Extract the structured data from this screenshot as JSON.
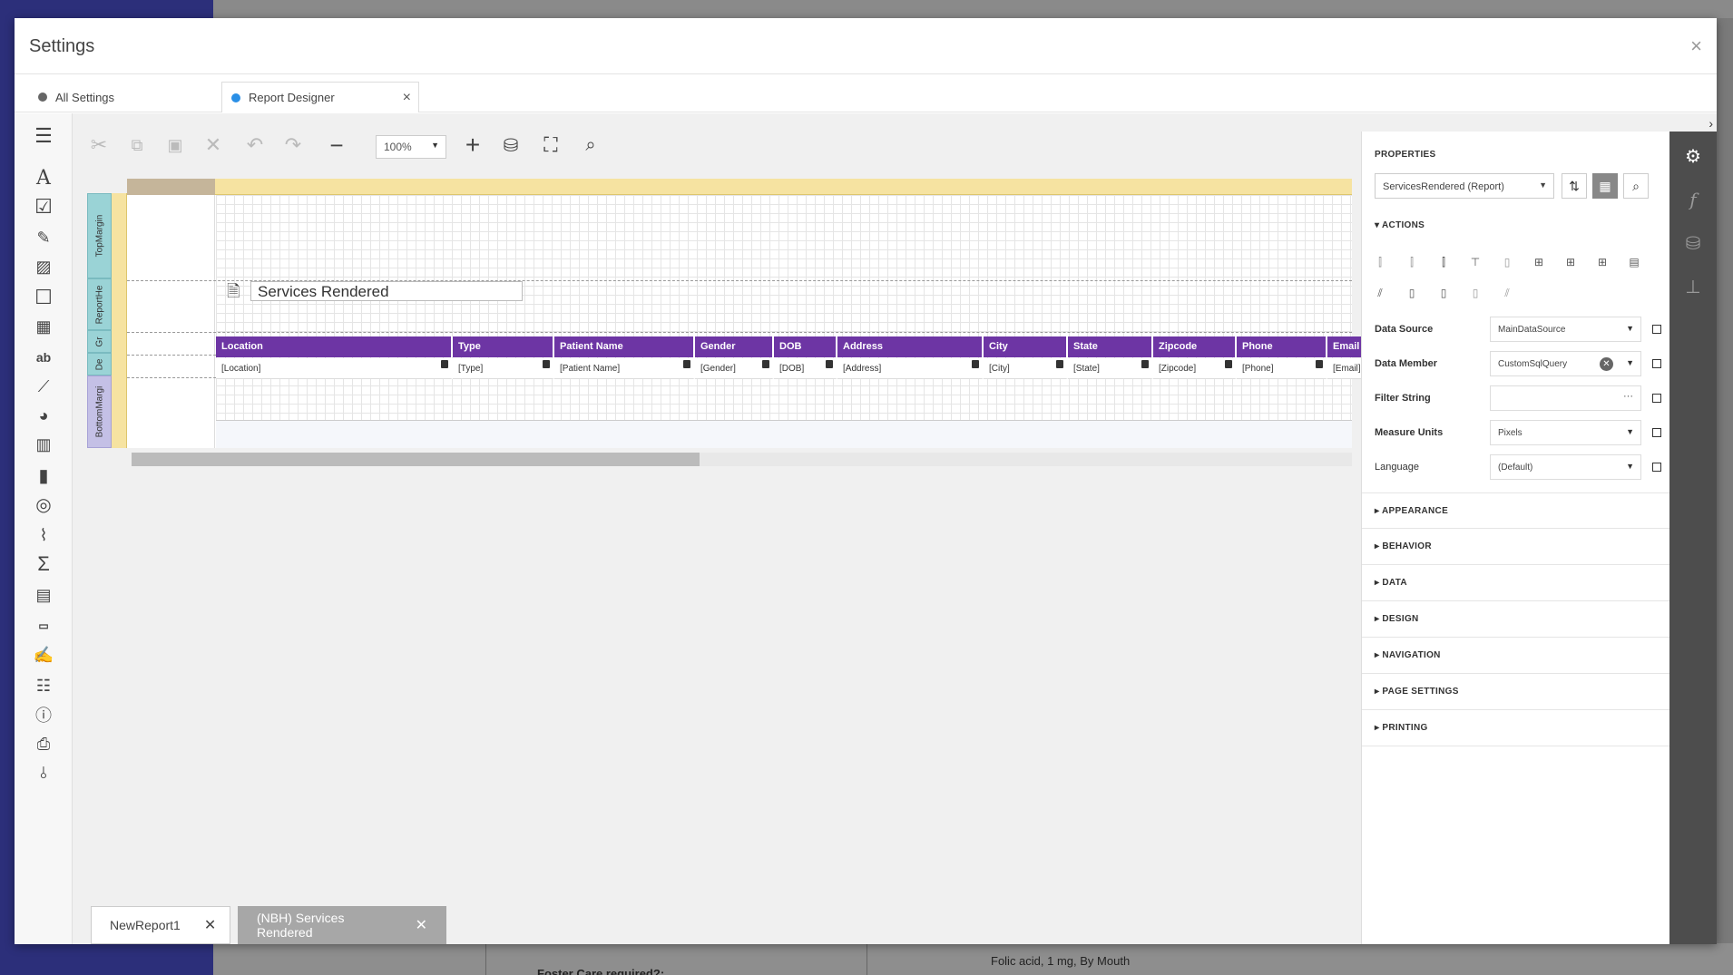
{
  "modal": {
    "title": "Settings",
    "close": "×"
  },
  "tabs": [
    {
      "label": "All Settings"
    },
    {
      "label": "Report Designer",
      "close": "×"
    }
  ],
  "toolbar": {
    "zoom": "100%"
  },
  "report": {
    "title": "Services Rendered",
    "bands": {
      "top_margin": "TopMargin",
      "report_header": "ReportHe",
      "group_header": "Gr",
      "detail": "De",
      "bottom_margin": "BottomMargi"
    },
    "columns": [
      "Location",
      "Type",
      "Patient Name",
      "Gender",
      "DOB",
      "Address",
      "City",
      "State",
      "Zipcode",
      "Phone",
      "Email"
    ],
    "fields": [
      "[Location]",
      "[Type]",
      "[Patient Name]",
      "[Gender]",
      "[DOB]",
      "[Address]",
      "[City]",
      "[State]",
      "[Zipcode]",
      "[Phone]",
      "[Email]"
    ]
  },
  "doc_tabs": [
    {
      "label": "NewReport1",
      "close": "✕"
    },
    {
      "label": "(NBH) Services Rendered",
      "close": "✕"
    }
  ],
  "properties": {
    "title": "PROPERTIES",
    "selected": "ServicesRendered (Report)",
    "actions_label": "ACTIONS",
    "rows": [
      {
        "label": "Data Source",
        "value": "MainDataSource"
      },
      {
        "label": "Data Member",
        "value": "CustomSqlQuery"
      },
      {
        "label": "Filter String",
        "value": ""
      },
      {
        "label": "Measure Units",
        "value": "Pixels"
      },
      {
        "label": "Language",
        "value": "(Default)"
      }
    ],
    "sections": [
      "APPEARANCE",
      "BEHAVIOR",
      "DATA",
      "DESIGN",
      "NAVIGATION",
      "PAGE SETTINGS",
      "PRINTING"
    ]
  },
  "background": {
    "text1": "Foster Care required?:",
    "text2": "Folic acid, 1 mg, By Mouth"
  }
}
